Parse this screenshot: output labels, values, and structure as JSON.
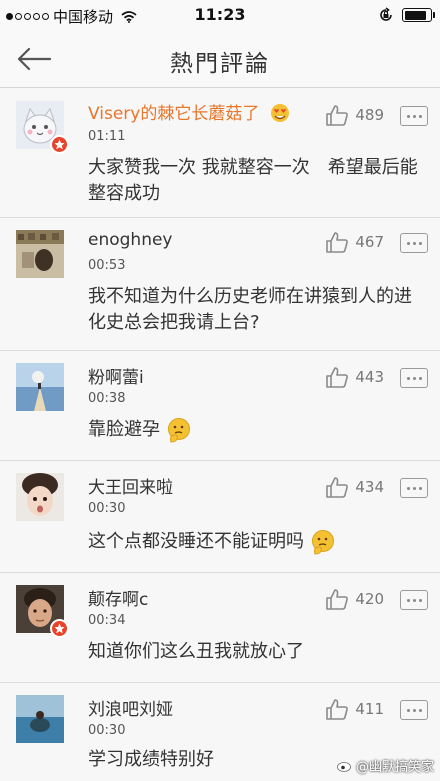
{
  "status_bar": {
    "carrier": "中国移动",
    "time": "11:23",
    "signal_bars_filled": 1,
    "signal_bars_total": 5,
    "battery_level": 0.85
  },
  "nav": {
    "back_icon": "back-arrow-icon",
    "title": "熱門評論"
  },
  "comments": [
    {
      "username": "Visery的棘它长蘑菇了",
      "vip": true,
      "time": "01:11",
      "text": "大家赞我一次 我就整容一次　希望最后能整容成功",
      "likes": "489",
      "badge": true
    },
    {
      "username": "enoghney",
      "vip": false,
      "time": "00:53",
      "text": "我不知道为什么历史老师在讲猿到人的进化史总会把我请上台?",
      "likes": "467",
      "badge": false
    },
    {
      "username": "粉啊蕾i",
      "vip": false,
      "time": "00:38",
      "text": "靠脸避孕",
      "likes": "443",
      "badge": false
    },
    {
      "username": "大王回来啦",
      "vip": false,
      "time": "00:30",
      "text": "这个点都没睡还不能证明吗",
      "likes": "434",
      "badge": false
    },
    {
      "username": "颠存啊c",
      "vip": false,
      "time": "00:34",
      "text": "知道你们这么丑我就放心了",
      "likes": "420",
      "badge": true
    },
    {
      "username": "刘浪吧刘娅",
      "vip": false,
      "time": "00:30",
      "text": "学习成绩特别好",
      "likes": "411",
      "badge": false
    }
  ],
  "watermark": "@幽默搞笑家",
  "colors": {
    "vip_name": "#e8762b",
    "badge": "#e8442c",
    "background": "#f7f7f7"
  }
}
